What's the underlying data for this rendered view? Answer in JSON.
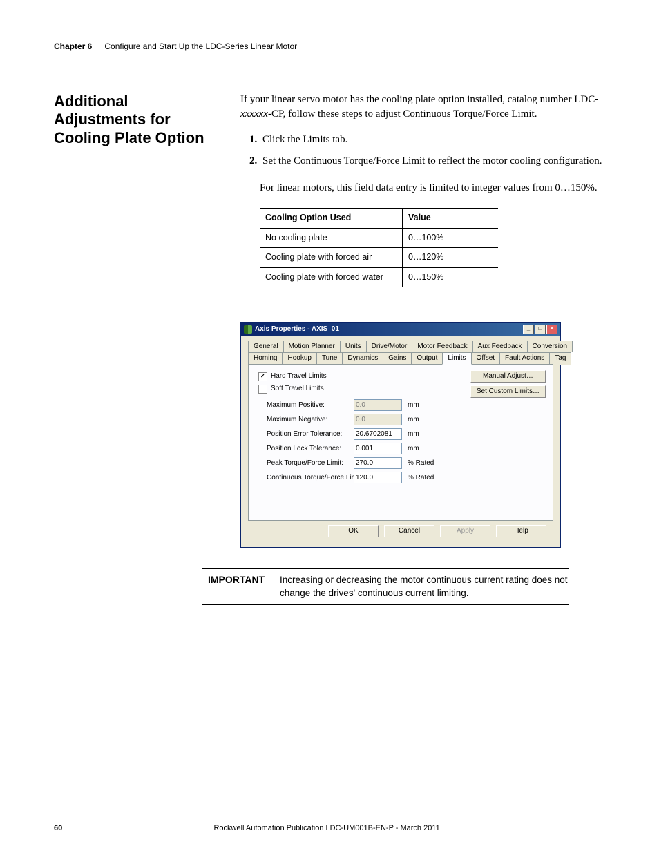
{
  "header": {
    "chapter_label": "Chapter 6",
    "chapter_title": "Configure and Start Up the LDC-Series Linear Motor"
  },
  "section_heading": "Additional Adjustments for Cooling Plate Option",
  "intro_before_italic": "If your linear servo motor has the cooling plate option installed, catalog number LDC-",
  "intro_italic": "xxxxxx",
  "intro_after_italic": "-CP, follow these steps to adjust Continuous Torque/Force Limit.",
  "steps": [
    "Click the Limits tab.",
    "Set the Continuous Torque/Force Limit to reflect the motor cooling configuration."
  ],
  "note": "For linear motors, this field data entry is limited to integer values from 0…150%.",
  "table": {
    "headers": [
      "Cooling Option Used",
      "Value"
    ],
    "rows": [
      [
        "No cooling plate",
        "0…100%"
      ],
      [
        "Cooling plate with forced air",
        "0…120%"
      ],
      [
        "Cooling plate with forced water",
        "0…150%"
      ]
    ]
  },
  "dialog": {
    "title": "Axis Properties - AXIS_01",
    "tabs_row1": [
      "General",
      "Motion Planner",
      "Units",
      "Drive/Motor",
      "Motor Feedback",
      "Aux Feedback",
      "Conversion"
    ],
    "tabs_row2": [
      "Homing",
      "Hookup",
      "Tune",
      "Dynamics",
      "Gains",
      "Output",
      "Limits",
      "Offset",
      "Fault Actions",
      "Tag"
    ],
    "active_tab": "Limits",
    "side_buttons": [
      "Manual Adjust…",
      "Set Custom Limits…"
    ],
    "checkboxes": [
      {
        "label": "Hard Travel Limits",
        "checked": true
      },
      {
        "label": "Soft Travel Limits",
        "checked": false
      }
    ],
    "fields": [
      {
        "label": "Maximum Positive:",
        "value": "0.0",
        "unit": "mm",
        "disabled": true
      },
      {
        "label": "Maximum Negative:",
        "value": "0.0",
        "unit": "mm",
        "disabled": true
      },
      {
        "label": "Position Error Tolerance:",
        "value": "20.6702081",
        "unit": "mm",
        "disabled": false
      },
      {
        "label": "Position Lock Tolerance:",
        "value": "0.001",
        "unit": "mm",
        "disabled": false
      },
      {
        "label": "Peak Torque/Force Limit:",
        "value": "270.0",
        "unit": "% Rated",
        "disabled": false
      },
      {
        "label": "Continuous Torque/Force Limit:",
        "value": "120.0",
        "unit": "% Rated",
        "disabled": false
      }
    ],
    "footer_buttons": [
      {
        "label": "OK",
        "disabled": false
      },
      {
        "label": "Cancel",
        "disabled": false
      },
      {
        "label": "Apply",
        "disabled": true
      },
      {
        "label": "Help",
        "disabled": false
      }
    ]
  },
  "important": {
    "label": "IMPORTANT",
    "text": "Increasing or decreasing the motor continuous current rating does not change the drives' continuous current limiting."
  },
  "footer": {
    "page_num": "60",
    "publication": "Rockwell Automation Publication LDC-UM001B-EN-P - March 2011"
  }
}
